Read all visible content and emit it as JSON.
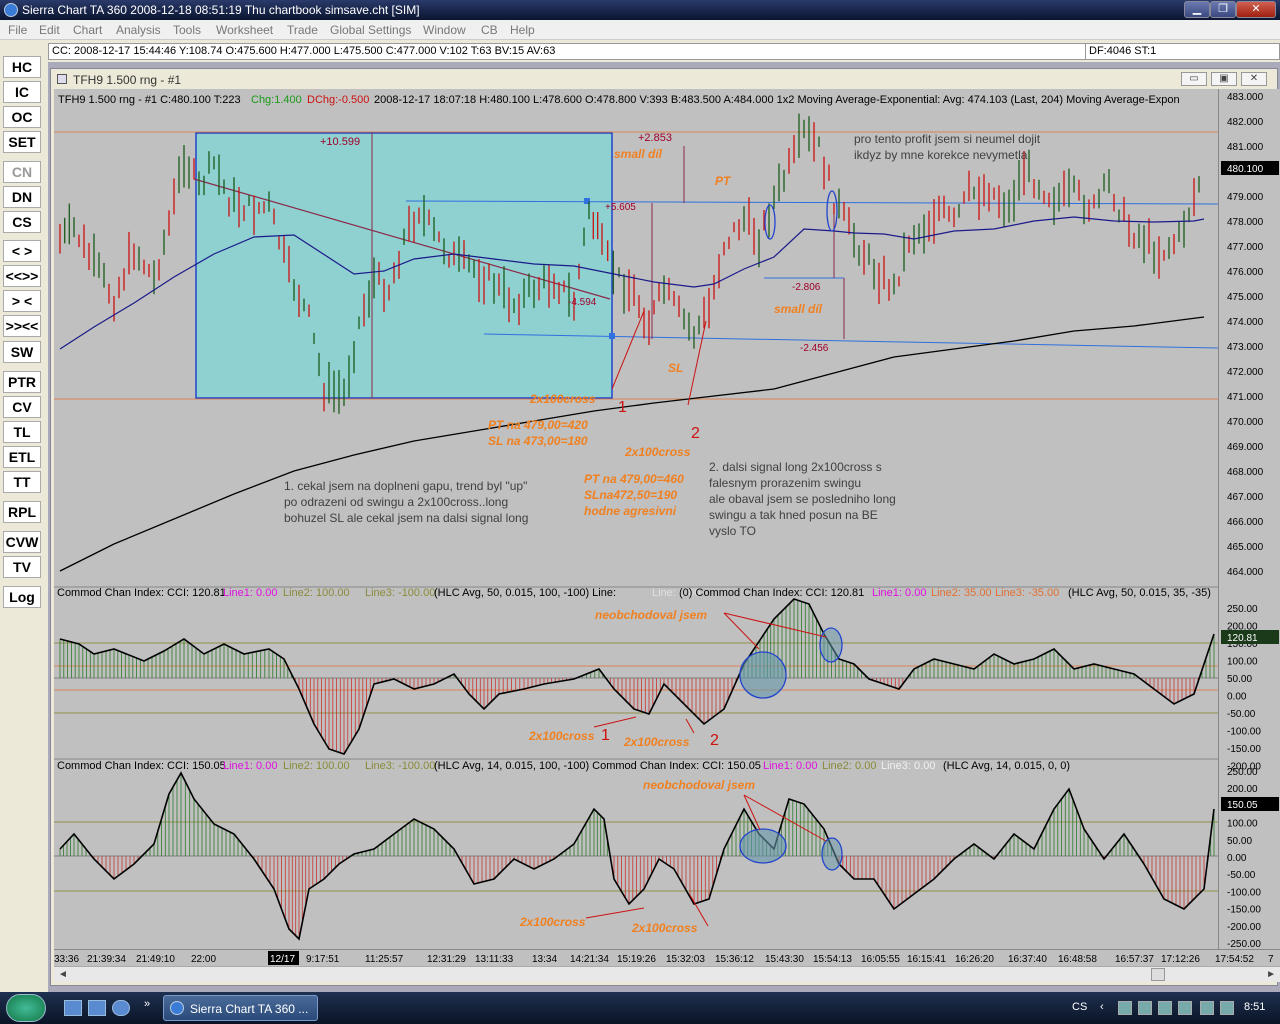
{
  "window": {
    "title": "Sierra Chart TA 360  2008-12-18  08:51:19  Thu    chartbook simsave.cht [SIM]",
    "controls": [
      "▁",
      "❐",
      "✕"
    ]
  },
  "menu": [
    "File",
    "Edit",
    "Chart",
    "Analysis",
    "Tools",
    "Worksheet",
    "Trade",
    "Global Settings",
    "Window",
    "CB",
    "Help"
  ],
  "status": {
    "left": "CC: 2008-12-17  15:44:46  Y:108.74  O:475.600  H:477.000  L:475.500  C:477.000  V:102  T:63  BV:15  AV:63",
    "right": "DF:4046  ST:1"
  },
  "toolbar": [
    {
      "label": "HC",
      "enabled": true
    },
    {
      "label": "IC",
      "enabled": true
    },
    {
      "label": "OC",
      "enabled": true
    },
    {
      "label": "SET",
      "enabled": true
    },
    {
      "label": "CN",
      "enabled": false
    },
    {
      "label": "DN",
      "enabled": true
    },
    {
      "label": "CS",
      "enabled": true
    },
    {
      "label": "< >",
      "enabled": true
    },
    {
      "label": "<<>>",
      "enabled": true
    },
    {
      "label": "> <",
      "enabled": true
    },
    {
      "label": ">><<",
      "enabled": true
    },
    {
      "label": "SW",
      "enabled": true
    },
    {
      "label": "PTR",
      "enabled": true
    },
    {
      "label": "CV",
      "enabled": true
    },
    {
      "label": "TL",
      "enabled": true
    },
    {
      "label": "ETL",
      "enabled": true
    },
    {
      "label": "TT",
      "enabled": true
    },
    {
      "label": "RPL",
      "enabled": true
    },
    {
      "label": "CVW",
      "enabled": true
    },
    {
      "label": "TV",
      "enabled": true
    },
    {
      "label": "Log",
      "enabled": true
    }
  ],
  "chart_window": {
    "title": "TFH9  1.500 rng - #1",
    "controls": [
      "▭",
      "▣",
      "✕"
    ]
  },
  "chart_header": {
    "symbol": "TFH9  1.500 rng - #1  C:480.100  T:223",
    "chg": "Chg:1.400",
    "dchg": "DChg:-0.500",
    "rest": "2008-12-17  18:07:18  H:480.100  L:478.600  O:478.800  V:393  B:483.500  A:484.000  1x2    Moving Average-Exponential:  Avg: 474.103   (Last, 204)   Moving Average-Expon"
  },
  "price_axis": [
    "483.000",
    "482.000",
    "481.000",
    "480.000",
    "479.000",
    "478.000",
    "477.000",
    "476.000",
    "475.000",
    "474.000",
    "473.000",
    "472.000",
    "471.000",
    "470.000",
    "469.000",
    "468.000",
    "467.000",
    "466.000",
    "465.000",
    "464.000"
  ],
  "last_price": "480.100",
  "cci1_axis": [
    "250.00",
    "200.00",
    "150.00",
    "100.00",
    "50.00",
    "0.00",
    "-50.00",
    "-100.00",
    "-150.00",
    "-200.00"
  ],
  "cci1_last": "120.81",
  "cci2_axis": [
    "250.00",
    "200.00",
    "150.00",
    "100.00",
    "50.00",
    "0.00",
    "-50.00",
    "-100.00",
    "-150.00",
    "-200.00",
    "-250.00"
  ],
  "cci2_last": "150.05",
  "cci1_header": {
    "a": "Commod Chan Index:  CCI: 120.81",
    "b": "Line1: 0.00",
    "c": "Line2: 100.00",
    "d": "Line3: -100.00",
    "e": "(HLC Avg, 50, 0.015, 100, -100)   Line:",
    "f": "Line: 0.00",
    "g": "(0)   Commod Chan Index:  CCI: 120.81",
    "h": "Line1: 0.00",
    "i": "Line2: 35.00",
    "j": "Line3: -35.00",
    "k": "(HLC Avg, 50, 0.015, 35, -35)"
  },
  "cci2_header": {
    "a": "Commod Chan Index:  CCI: 150.05",
    "b": "Line1: 0.00",
    "c": "Line2: 100.00",
    "d": "Line3: -100.00",
    "e": "(HLC Avg, 14, 0.015, 100, -100)   Commod Chan Index:  CCI: 150.05",
    "f": "Line1: 0.00",
    "g": "Line2: 0.00",
    "h": "Line3: 0.00",
    "i": "(HLC Avg, 14, 0.015, 0, 0)"
  },
  "time_axis": [
    "33:36",
    "21:39:34",
    "21:49:10",
    "22:00",
    "12/17",
    "9:17:51",
    "11:25:57",
    "12:31:29",
    "13:11:33",
    "13:34",
    "14:21:34",
    "15:19:26",
    "15:32:03",
    "15:36:12",
    "15:43:30",
    "15:54:13",
    "16:05:55",
    "16:15:41",
    "16:26:20",
    "16:37:40",
    "16:48:58",
    "16:57:37",
    "17:12:26",
    "17:54:52",
    "7"
  ],
  "annotations": {
    "box_profit": "+10.599",
    "small_dil_top_value": "+2.853",
    "small_dil_top": "small díl",
    "pt_label": "PT",
    "plus5605": "+5.605",
    "minus4594": "-4.594",
    "minus2806": "-2.806",
    "minus2456": "-2.456",
    "small_dil_bottom": "small díl",
    "sl_label": "SL",
    "cross1": "2x100cross",
    "num1": "1",
    "num2": "2",
    "pt_note1a": "PT na 479,00=420",
    "pt_note1b": "SL na 473,00=180",
    "cross2": "2x100cross",
    "pt_note2a": "PT na 479,00=460",
    "pt_note2b": "SLna472,50=190",
    "pt_note2c": "hodne agresivni",
    "profit_note1": "pro tento profit jsem si neumel dojit",
    "profit_note2": "ikdyz by mne korekce nevymetla",
    "note_left1": "1. cekal jsem na doplneni gapu, trend byl \"up\"",
    "note_left2": "po odrazeni od swingu a 2x100cross..long",
    "note_left3": "bohuzel SL ale cekal jsem na dalsi signal long",
    "note_right1": "2. dalsi signal long 2x100cross s",
    "note_right2": "falesnym prorazenim swingu",
    "note_right3": "ale obaval jsem se posledniho long",
    "note_right4": "swingu a tak hned posun na BE",
    "note_right5": "vyslo TO",
    "cci1_neob": "neobchodoval jsem",
    "cci1_cross1": "2x100cross",
    "cci1_num1": "1",
    "cci1_cross2": "2x100cross",
    "cci1_num2": "2",
    "cci2_neob": "neobchodoval jsem",
    "cci2_cross1": "2x100cross",
    "cci2_cross2": "2x100cross"
  },
  "colors": {
    "chart_bg": "#c0c0c0",
    "box_fill": "#8fd0d0",
    "box_border": "#2244cc",
    "ma_short": "#1a1a8a",
    "ma_long": "#000000",
    "up_bar": "#1a5a1a",
    "down_bar": "#cc1111",
    "annotation_orange": "#f08020",
    "annotation_dark_red": "#a0002a",
    "note_text": "#404040",
    "level_line": "#e07030",
    "blue_line": "#3070e0"
  },
  "taskbar": {
    "task_label": "Sierra Chart TA 360  ...",
    "lang": "CS",
    "clock": "8:51"
  }
}
